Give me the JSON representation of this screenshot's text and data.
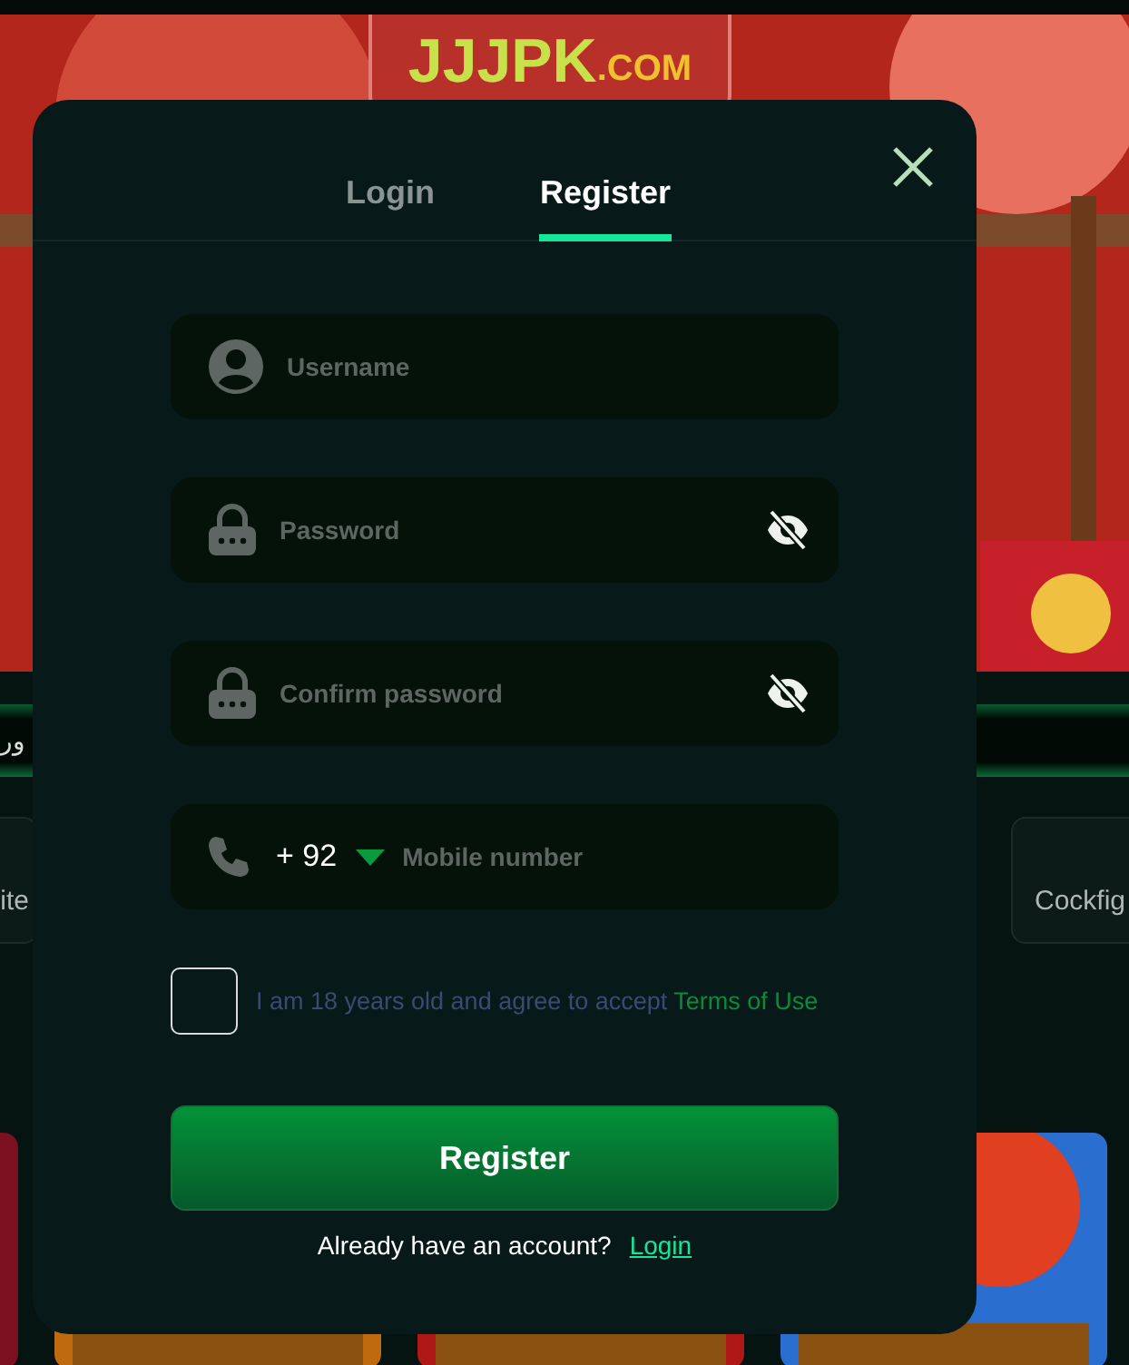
{
  "page": {
    "logo": {
      "brand": "JJJPK",
      "suffix": ".COM"
    },
    "marquee": {
      "text": "ور"
    },
    "categories": [
      {
        "label": "ite"
      },
      {
        "label": "Cockfig"
      }
    ]
  },
  "modal": {
    "tabs": [
      {
        "label": "Login",
        "selected": false
      },
      {
        "label": "Register",
        "selected": true
      }
    ],
    "fields": [
      {
        "kind": "user",
        "placeholder": "Username"
      },
      {
        "kind": "password",
        "placeholder": "Password",
        "visible": false
      },
      {
        "kind": "password",
        "placeholder": "Confirm password",
        "visible": false
      },
      {
        "kind": "phone",
        "prefix": "+ 92",
        "placeholder": "Mobile number"
      }
    ],
    "agreement": {
      "checked": false,
      "text": "I am 18 years old and agree to accept",
      "link": "Terms of Use"
    },
    "submit": "Register",
    "footer": {
      "text": "Already have an account?",
      "link": "Login"
    }
  }
}
